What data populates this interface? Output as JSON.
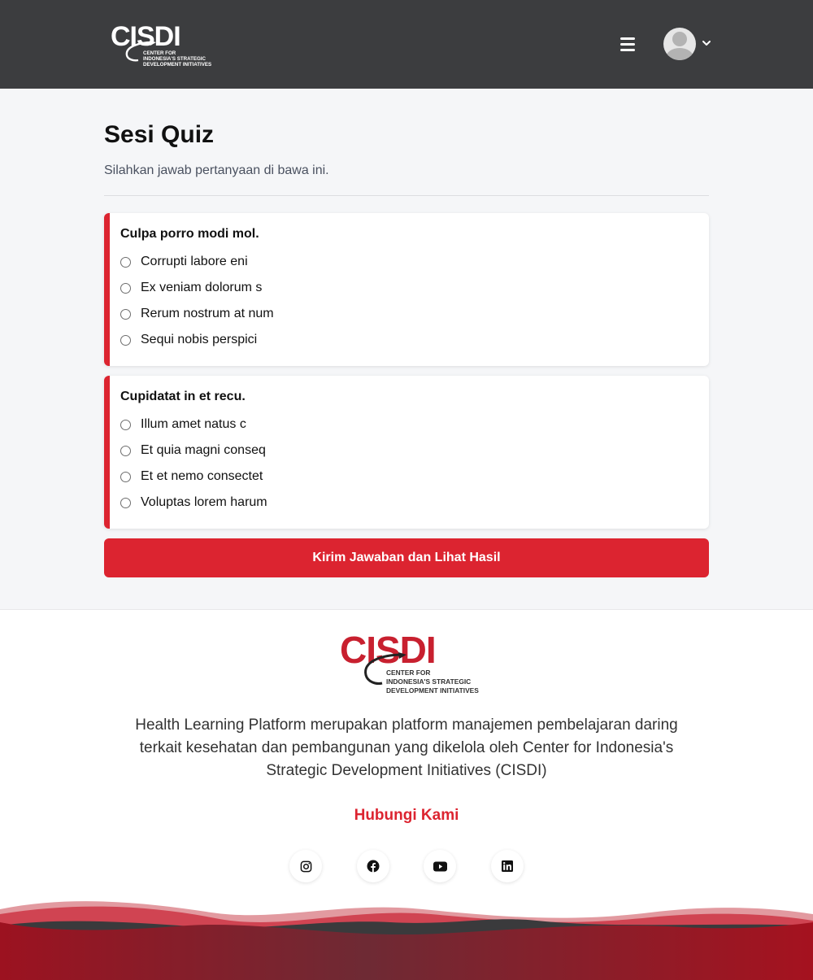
{
  "header": {
    "logo": {
      "mark": "CISDI",
      "tagline": "CENTER FOR\nINDONESIA'S STRATEGIC\nDEVELOPMENT INITIATIVES"
    },
    "menu_icon": "hamburger-icon",
    "avatar_icon": "user-avatar-icon",
    "dropdown_icon": "chevron-down-icon"
  },
  "quiz": {
    "title": "Sesi Quiz",
    "subtitle": "Silahkan jawab pertanyaan di bawa ini.",
    "questions": [
      {
        "text": "Culpa porro modi mol.",
        "options": [
          "Corrupti labore eni",
          "Ex veniam dolorum s",
          "Rerum nostrum at num",
          "Sequi nobis perspici"
        ]
      },
      {
        "text": "Cupidatat in et recu.",
        "options": [
          "Illum amet natus c",
          "Et quia magni conseq",
          "Et et nemo consectet",
          "Voluptas lorem harum"
        ]
      }
    ],
    "submit_label": "Kirim Jawaban dan Lihat Hasil"
  },
  "footer": {
    "logo": {
      "mark": "CISDI",
      "tagline": "CENTER FOR\nINDONESIA'S STRATEGIC\nDEVELOPMENT INITIATIVES"
    },
    "description": "Health Learning Platform merupakan platform manajemen pembelajaran daring terkait kesehatan dan pembangunan yang dikelola oleh Center for Indonesia's Strategic Development Initiatives (CISDI)",
    "contact_label": "Hubungi Kami",
    "social": [
      "instagram-icon",
      "facebook-icon",
      "youtube-icon",
      "linkedin-icon"
    ]
  },
  "colors": {
    "accent": "#dc2430",
    "header_bg": "#3c3d3f",
    "page_bg": "#f5f6f8",
    "footer_wave_dark": "#3a3a3c",
    "footer_wave_red": "#a5121f"
  }
}
